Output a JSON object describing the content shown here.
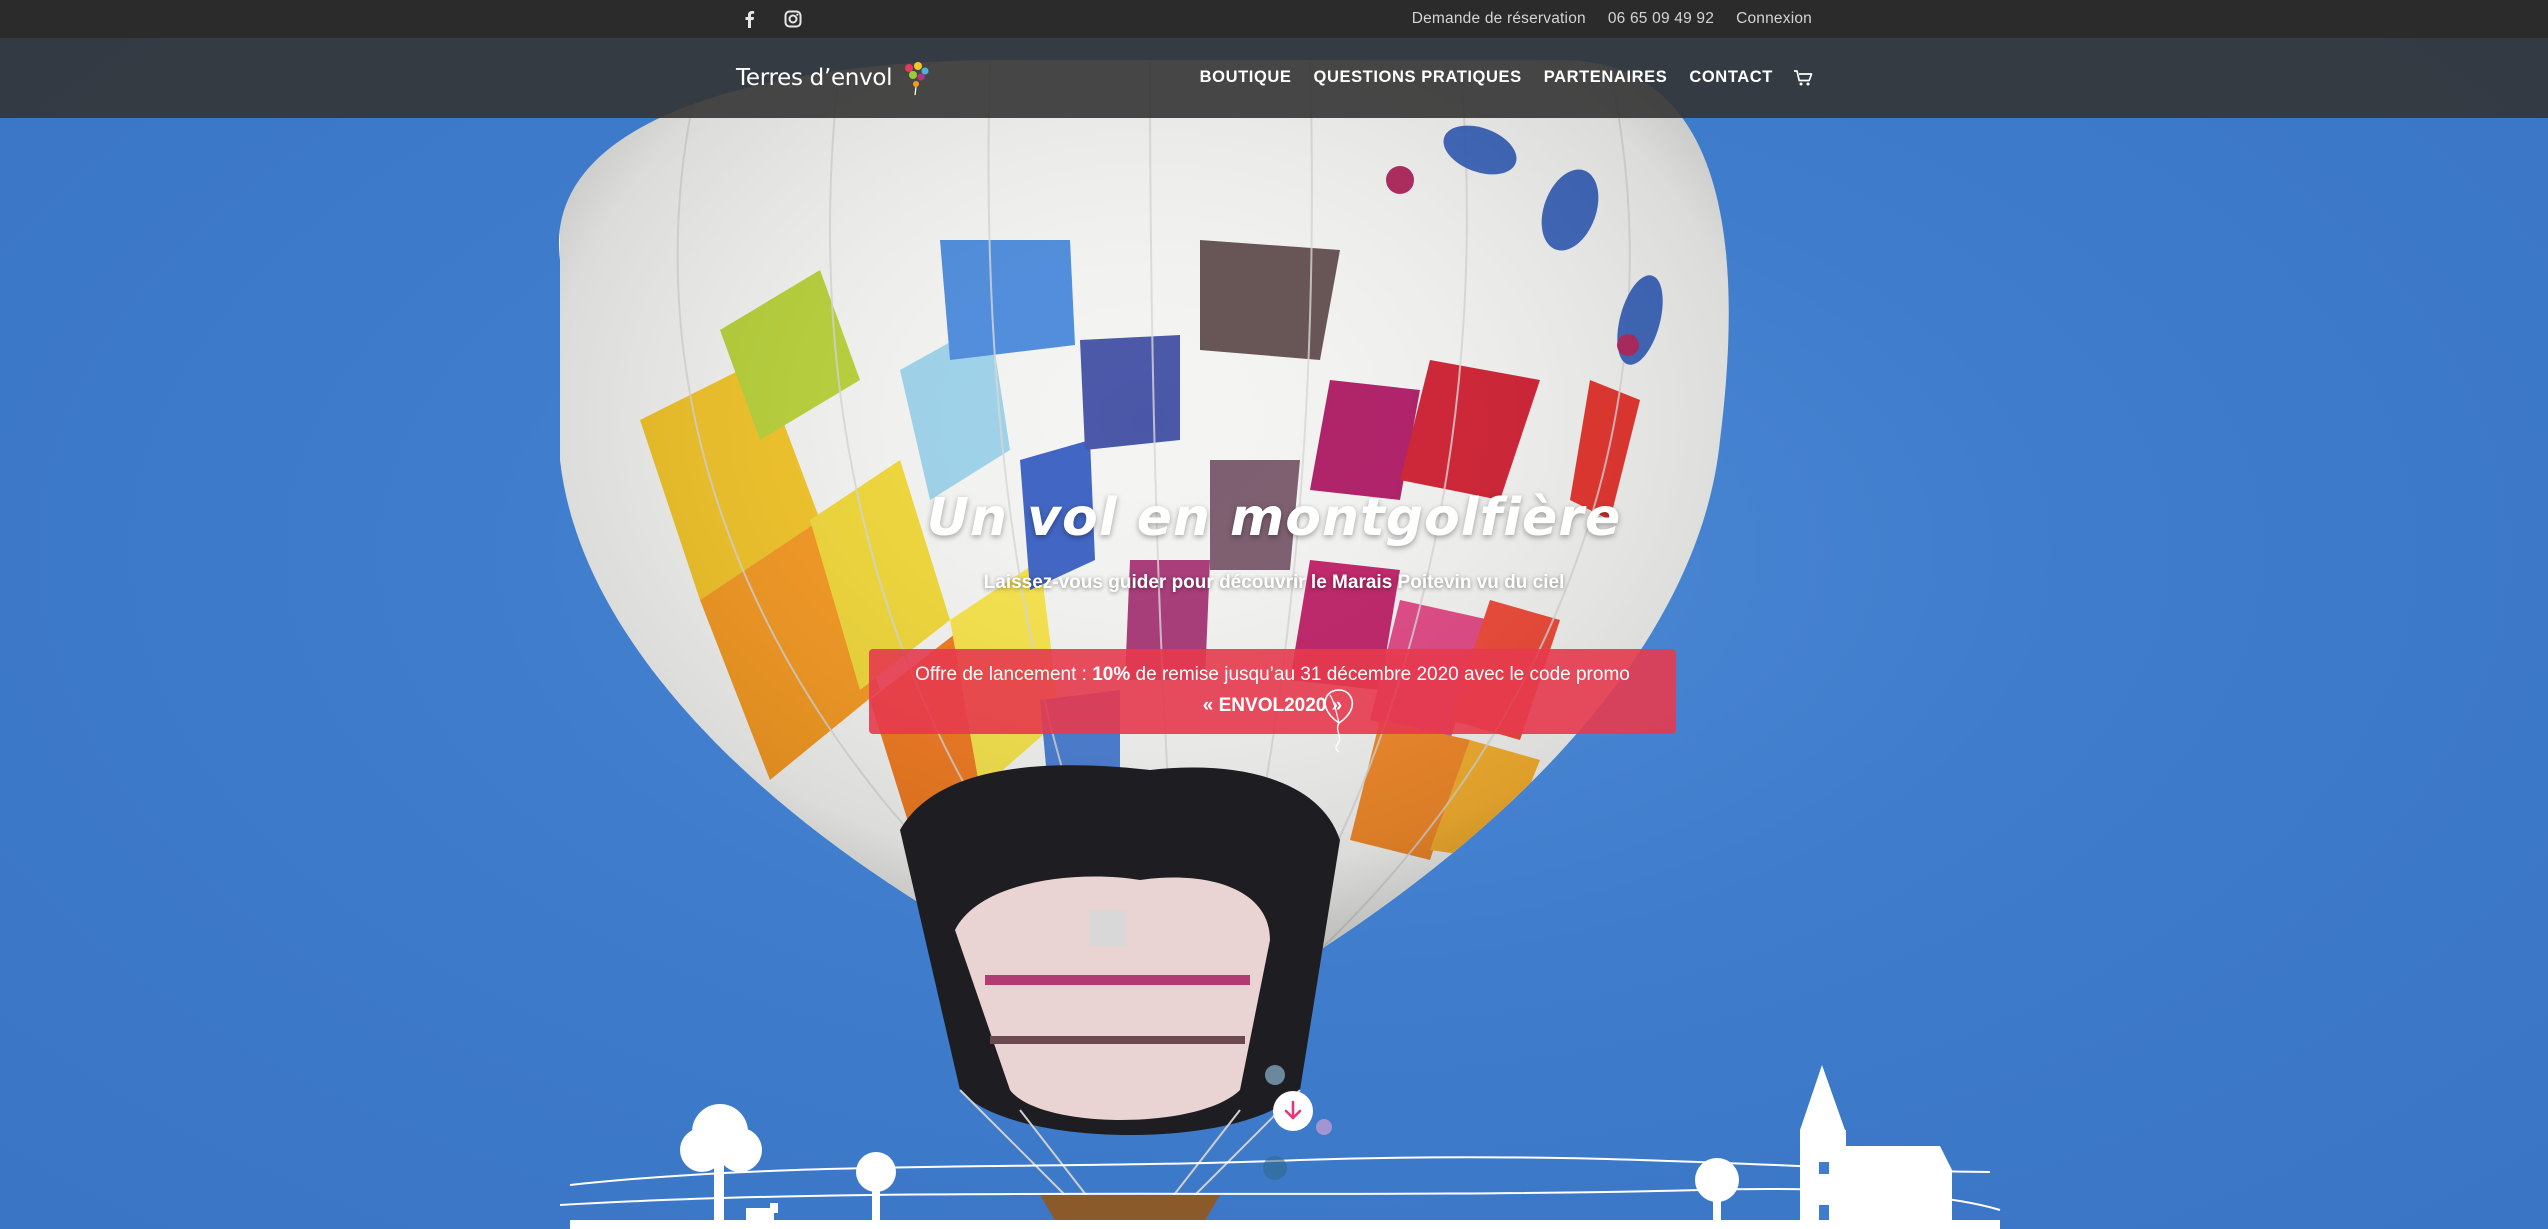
{
  "topbar": {
    "social": [
      {
        "icon": "facebook-icon"
      },
      {
        "icon": "instagram-icon"
      }
    ],
    "links": {
      "reservation": "Demande de réservation",
      "phone": "06 65 09 49 92",
      "login": "Connexion"
    }
  },
  "header": {
    "logo_text": "Terres d’envol",
    "nav": {
      "shop": "BOUTIQUE",
      "faq": "QUESTIONS PRATIQUES",
      "partners": "PARTENAIRES",
      "contact": "CONTACT"
    },
    "cart_icon": "cart-icon"
  },
  "hero": {
    "title": "Un vol en montgolfière",
    "subtitle": "Laissez-vous guider pour découvrir le Marais Poitevin vu du ciel",
    "promo": {
      "prefix": "Offre de lancement : ",
      "discount": "10%",
      "middle": " de remise jusqu’au 31 décembre 2020 avec le code promo",
      "code": "« ENVOL2020 »"
    },
    "scroll_icon": "arrow-down-icon"
  },
  "colors": {
    "topbar_bg": "#2b2b2b",
    "nav_bg": "#343434",
    "sky": "#3f7ccc",
    "promo_bg": "#e53a4e",
    "text": "#ffffff"
  }
}
